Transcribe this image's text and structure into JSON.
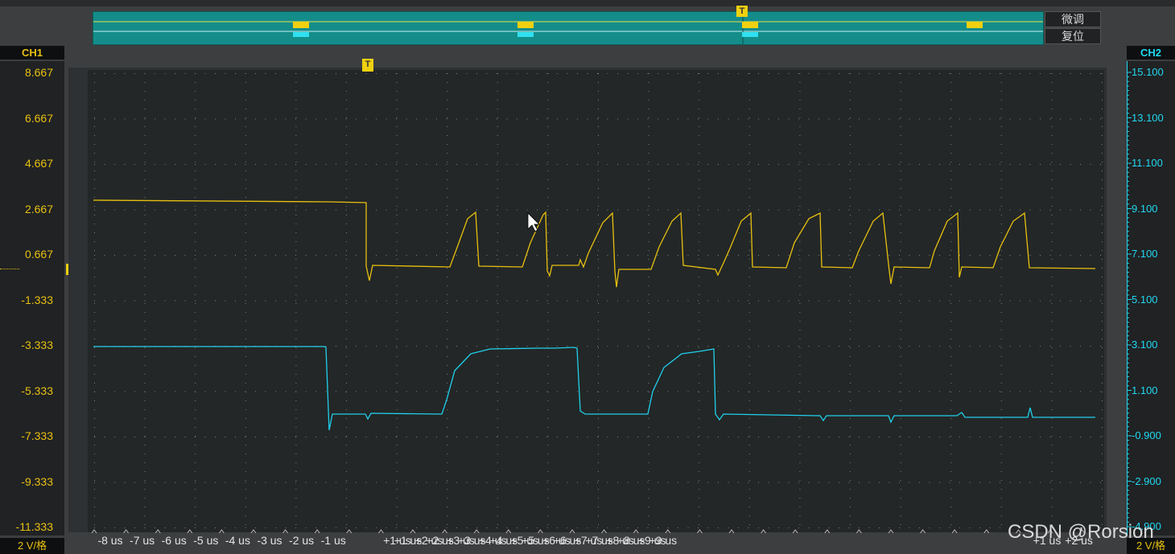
{
  "overview": {
    "fine_tune_label": "微调",
    "reset_label": "复位",
    "trigger_marker": "T"
  },
  "channels": {
    "ch1": {
      "label": "CH1",
      "color": "#e8c010"
    },
    "ch2": {
      "label": "CH2",
      "color": "#20d8f0"
    }
  },
  "left_axis": {
    "ticks": [
      "8.667",
      "6.667",
      "4.667",
      "2.667",
      "0.667",
      "-1.333",
      "-3.333",
      "-5.333",
      "-7.333",
      "-9.333",
      "-11.333"
    ],
    "scale": "2 V/格",
    "marker": "1"
  },
  "right_axis": {
    "ticks": [
      "15.100",
      "13.100",
      "11.100",
      "9.100",
      "7.100",
      "5.100",
      "3.100",
      "1.100",
      "-0.900",
      "-2.900",
      "-4.900"
    ],
    "scale": "2 V/格"
  },
  "trigger_marker": "T",
  "x_axis": {
    "labels_a": [
      "-8 us",
      "-7 us",
      "-6 us",
      "-5 us",
      "-4 us",
      "-3 us",
      "-2 us",
      "-1 us",
      "",
      "+1 us",
      "+2 us",
      "+3 us",
      "+4 us",
      "+5 us",
      "+6 us",
      "+7 us",
      "+8 us",
      "+9 us"
    ],
    "labels_b": [
      "+1 us",
      "+2 us",
      "+3 us",
      "+4 us",
      "+5 us",
      "+6 us",
      "+7 us",
      "+8 us",
      "+9 us"
    ],
    "labels_c": [
      "+1 us",
      "+2 us"
    ]
  },
  "watermark": "CSDN @Rorsion"
}
